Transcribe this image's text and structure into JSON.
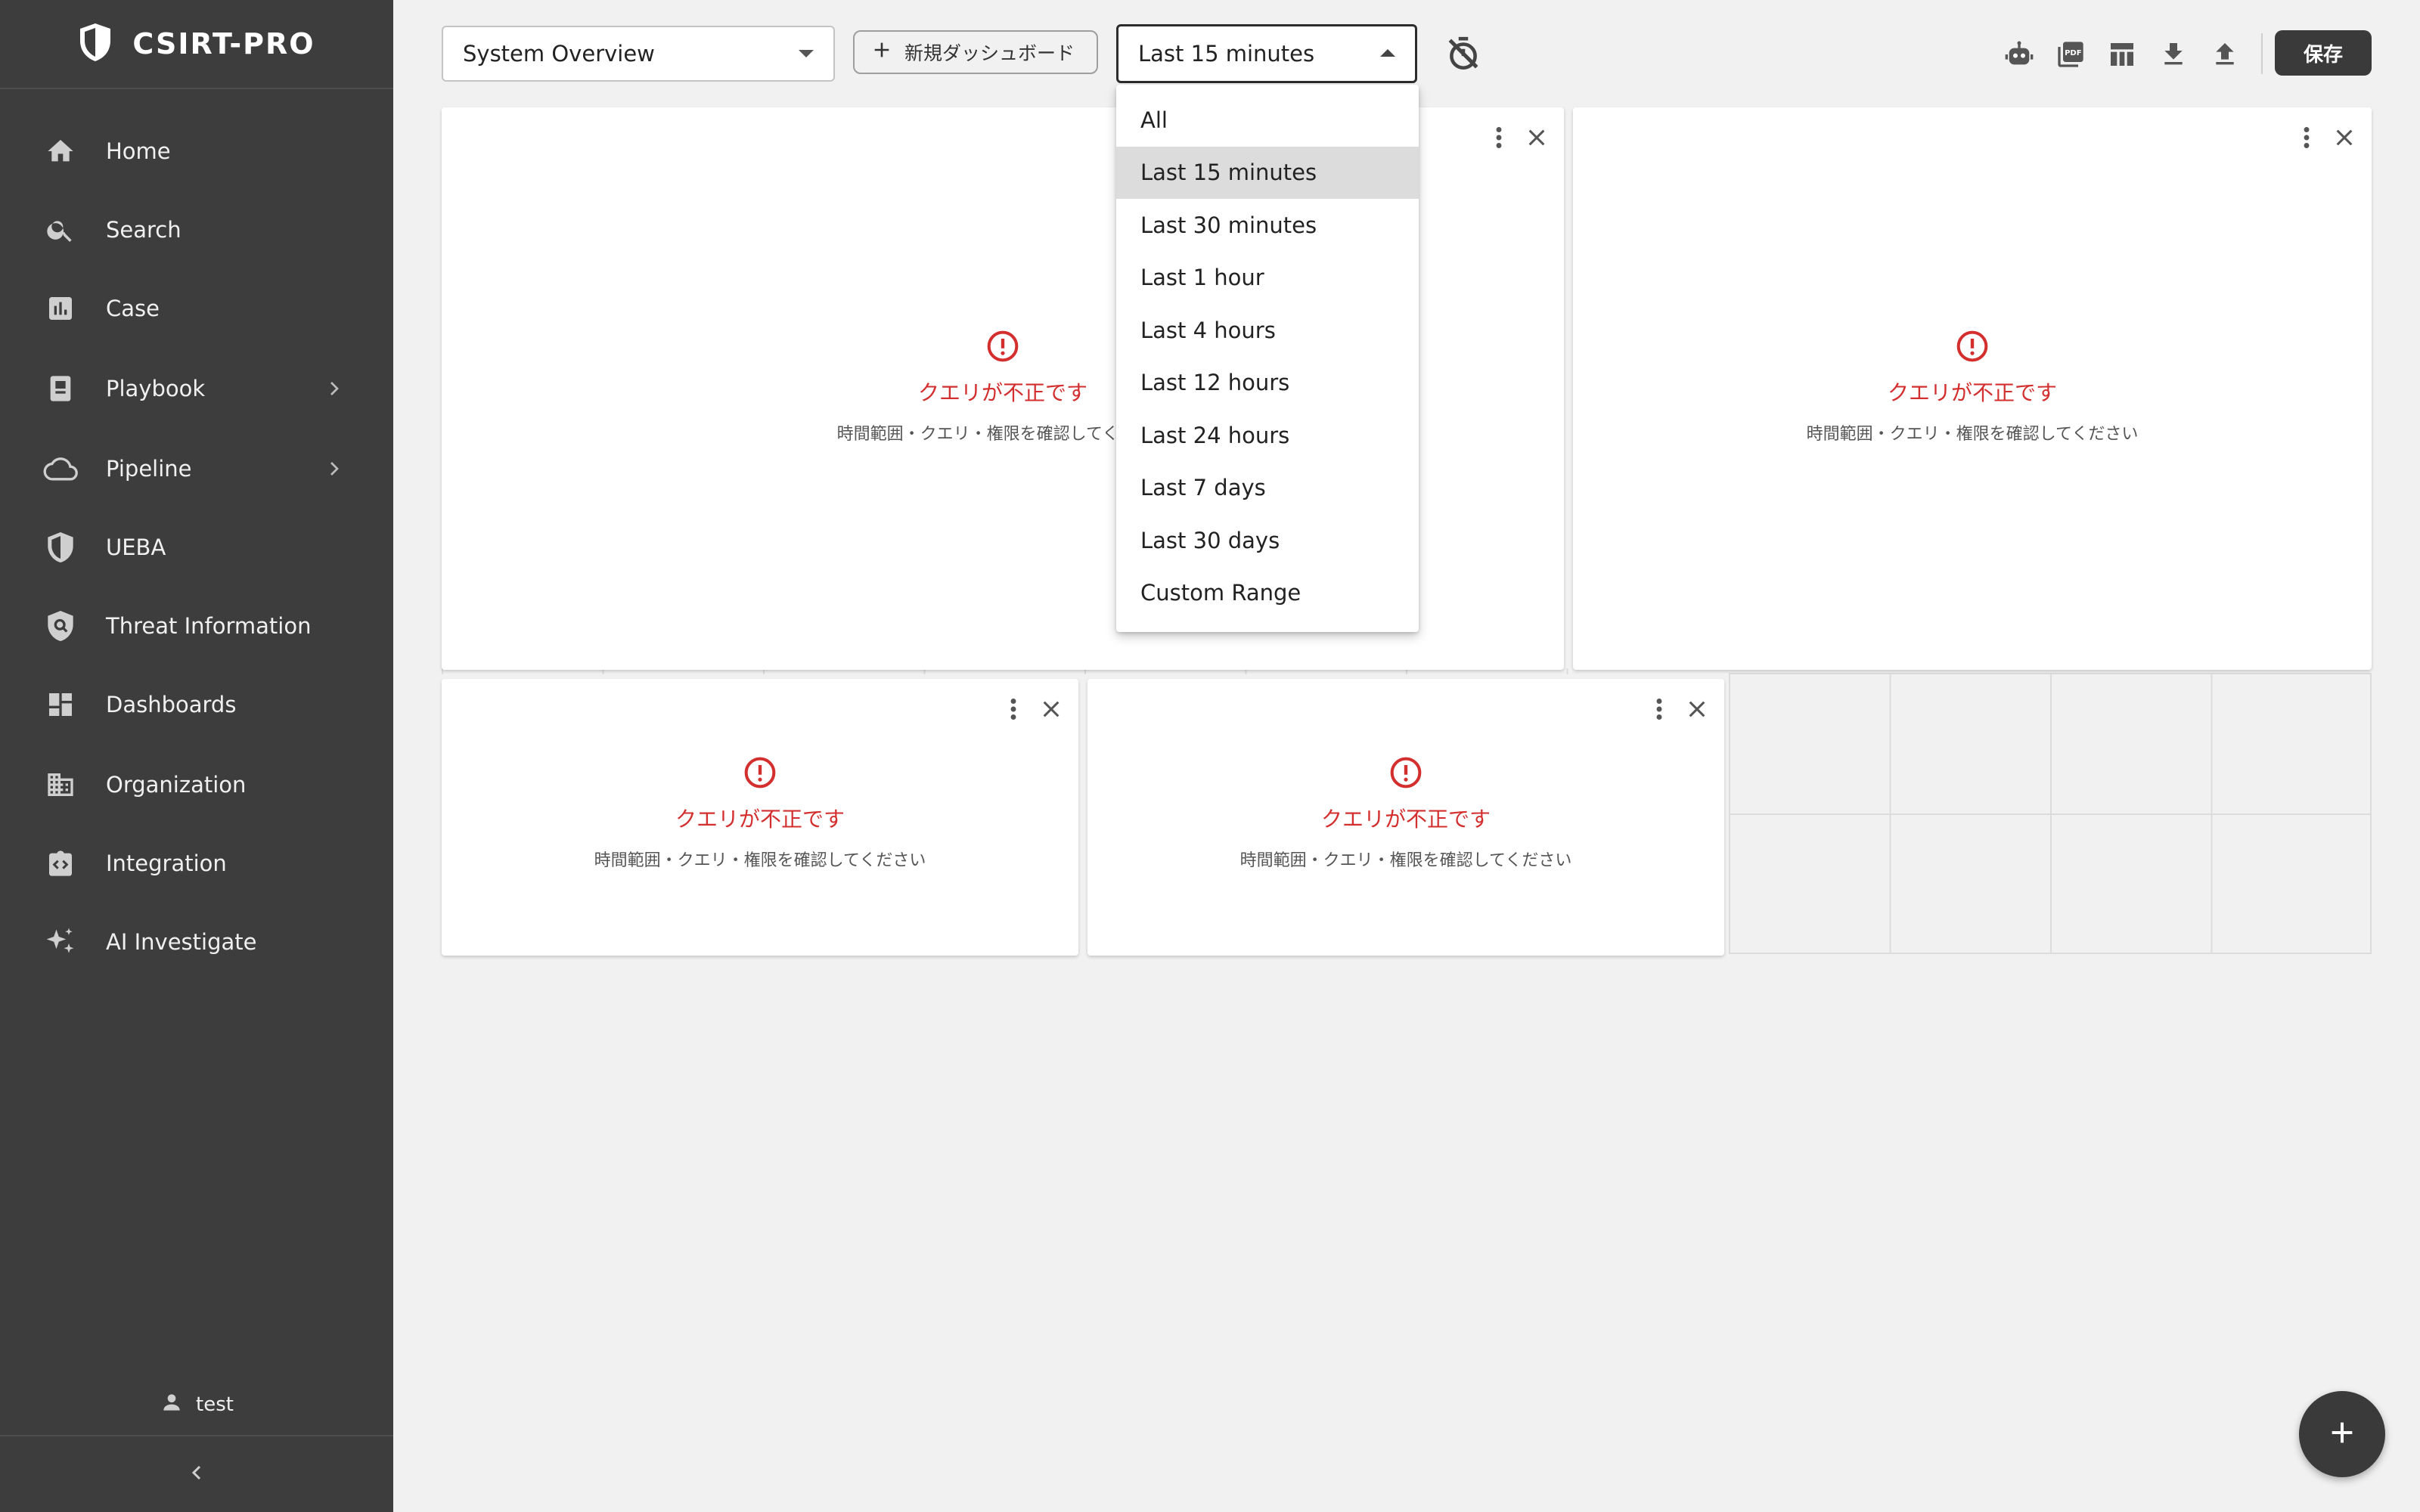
{
  "app": {
    "brand": "CSIRT-PRO"
  },
  "sidebar": {
    "items": [
      {
        "label": "Home",
        "icon": "home-icon"
      },
      {
        "label": "Search",
        "icon": "search-icon"
      },
      {
        "label": "Case",
        "icon": "bar-chart-icon"
      },
      {
        "label": "Playbook",
        "icon": "book-icon",
        "has_children": true
      },
      {
        "label": "Pipeline",
        "icon": "cloud-icon",
        "has_children": true
      },
      {
        "label": "UEBA",
        "icon": "shield-icon"
      },
      {
        "label": "Threat Information",
        "icon": "shield-search-icon"
      },
      {
        "label": "Dashboards",
        "icon": "dashboard-icon"
      },
      {
        "label": "Organization",
        "icon": "building-icon"
      },
      {
        "label": "Integration",
        "icon": "integration-icon"
      },
      {
        "label": "AI Investigate",
        "icon": "sparkle-icon"
      }
    ],
    "user": "test"
  },
  "toolbar": {
    "dashboard_select": "System Overview",
    "new_dashboard_label": "新規ダッシュボード",
    "time_range": "Last 15 minutes",
    "save_label": "保存",
    "icons": [
      "robot-icon",
      "pdf-icon",
      "table-layout-icon",
      "download-icon",
      "upload-icon"
    ]
  },
  "time_dropdown": {
    "options": [
      "All",
      "Last 15 minutes",
      "Last 30 minutes",
      "Last 1 hour",
      "Last 4 hours",
      "Last 12 hours",
      "Last 24 hours",
      "Last 7 days",
      "Last 30 days",
      "Custom Range"
    ],
    "selected": "Last 15 minutes"
  },
  "widgets": [
    {
      "error_title": "クエリが不正です",
      "error_sub": "時間範囲・クエリ・権限を確認してください"
    },
    {
      "error_title": "クエリが不正です",
      "error_sub": "時間範囲・クエリ・権限を確認してください"
    },
    {
      "error_title": "クエリが不正です",
      "error_sub": "時間範囲・クエリ・権限を確認してください"
    },
    {
      "error_title": "クエリが不正です",
      "error_sub": "時間範囲・クエリ・権限を確認してください"
    }
  ],
  "colors": {
    "sidebar_bg": "#3d3d3d",
    "error": "#d32f2f",
    "page_bg": "#f1f1f1",
    "primary_dark": "#3a3a3a"
  }
}
